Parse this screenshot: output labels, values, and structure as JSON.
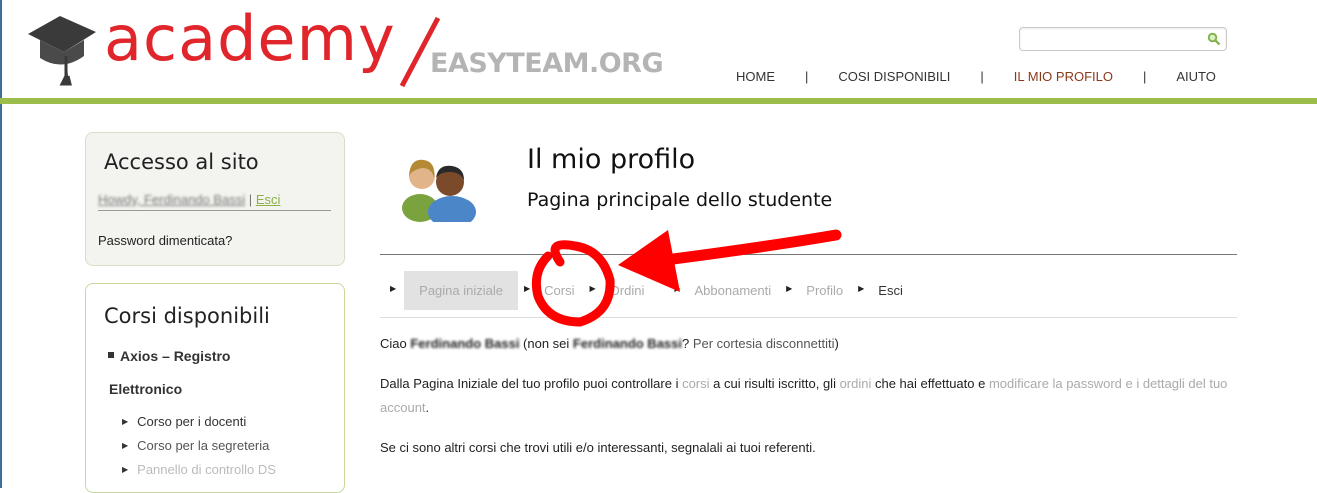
{
  "header": {
    "logo_main": "academy",
    "logo_sub": "EASYTEAM.ORG",
    "search": {
      "placeholder": "",
      "value": ""
    },
    "nav": [
      {
        "label": "HOME"
      },
      {
        "label": "COSI DISPONIBILI"
      },
      {
        "label": "IL MIO PROFILO",
        "active": true
      },
      {
        "label": "AIUTO"
      }
    ]
  },
  "sidebar": {
    "login_widget": {
      "title": "Accesso al sito",
      "howdy": "Howdy, Ferdinando Bassi",
      "separator": "|",
      "logout": "Esci",
      "lost_password": "Password dimenticata?"
    },
    "courses_widget": {
      "title": "Corsi disponibili",
      "category_1": "Axios – Registro",
      "category_2": "Elettronico",
      "items": [
        "Corso per i docenti",
        "Corso per la segreteria",
        "Pannello di controllo DS"
      ]
    }
  },
  "main": {
    "title": "Il mio profilo",
    "subtitle": "Pagina principale dello studente",
    "tabs": [
      {
        "label": "Pagina iniziale"
      },
      {
        "label": "Corsi"
      },
      {
        "label": "Ordini"
      },
      {
        "label": "Abbonamenti"
      },
      {
        "label": "Profilo"
      },
      {
        "label": "Esci"
      }
    ],
    "greeting": {
      "prefix": "Ciao ",
      "name": "Ferdinando Bassi",
      "not_you_prefix": " (non sei ",
      "name2": "Ferdinando Bassi",
      "not_you_suffix": "? ",
      "logout_link": "Per cortesia disconnettiti",
      "close": ")"
    },
    "intro": {
      "t1": "Dalla Pagina Iniziale del tuo profilo puoi controllare i ",
      "l1": "corsi",
      "t2": " a cui risulti iscritto, gli ",
      "l2": "ordini",
      "t3": " che hai effettuato e ",
      "l3": "modificare la password e i dettagli del tuo account",
      "t4": "."
    },
    "note": "Se ci sono altri corsi che trovi utili e/o interessanti, segnalali ai tuoi referenti."
  },
  "colors": {
    "brand_red": "#e0262b",
    "brand_green": "#9cbc4b",
    "annotation_red": "#ff0000"
  }
}
